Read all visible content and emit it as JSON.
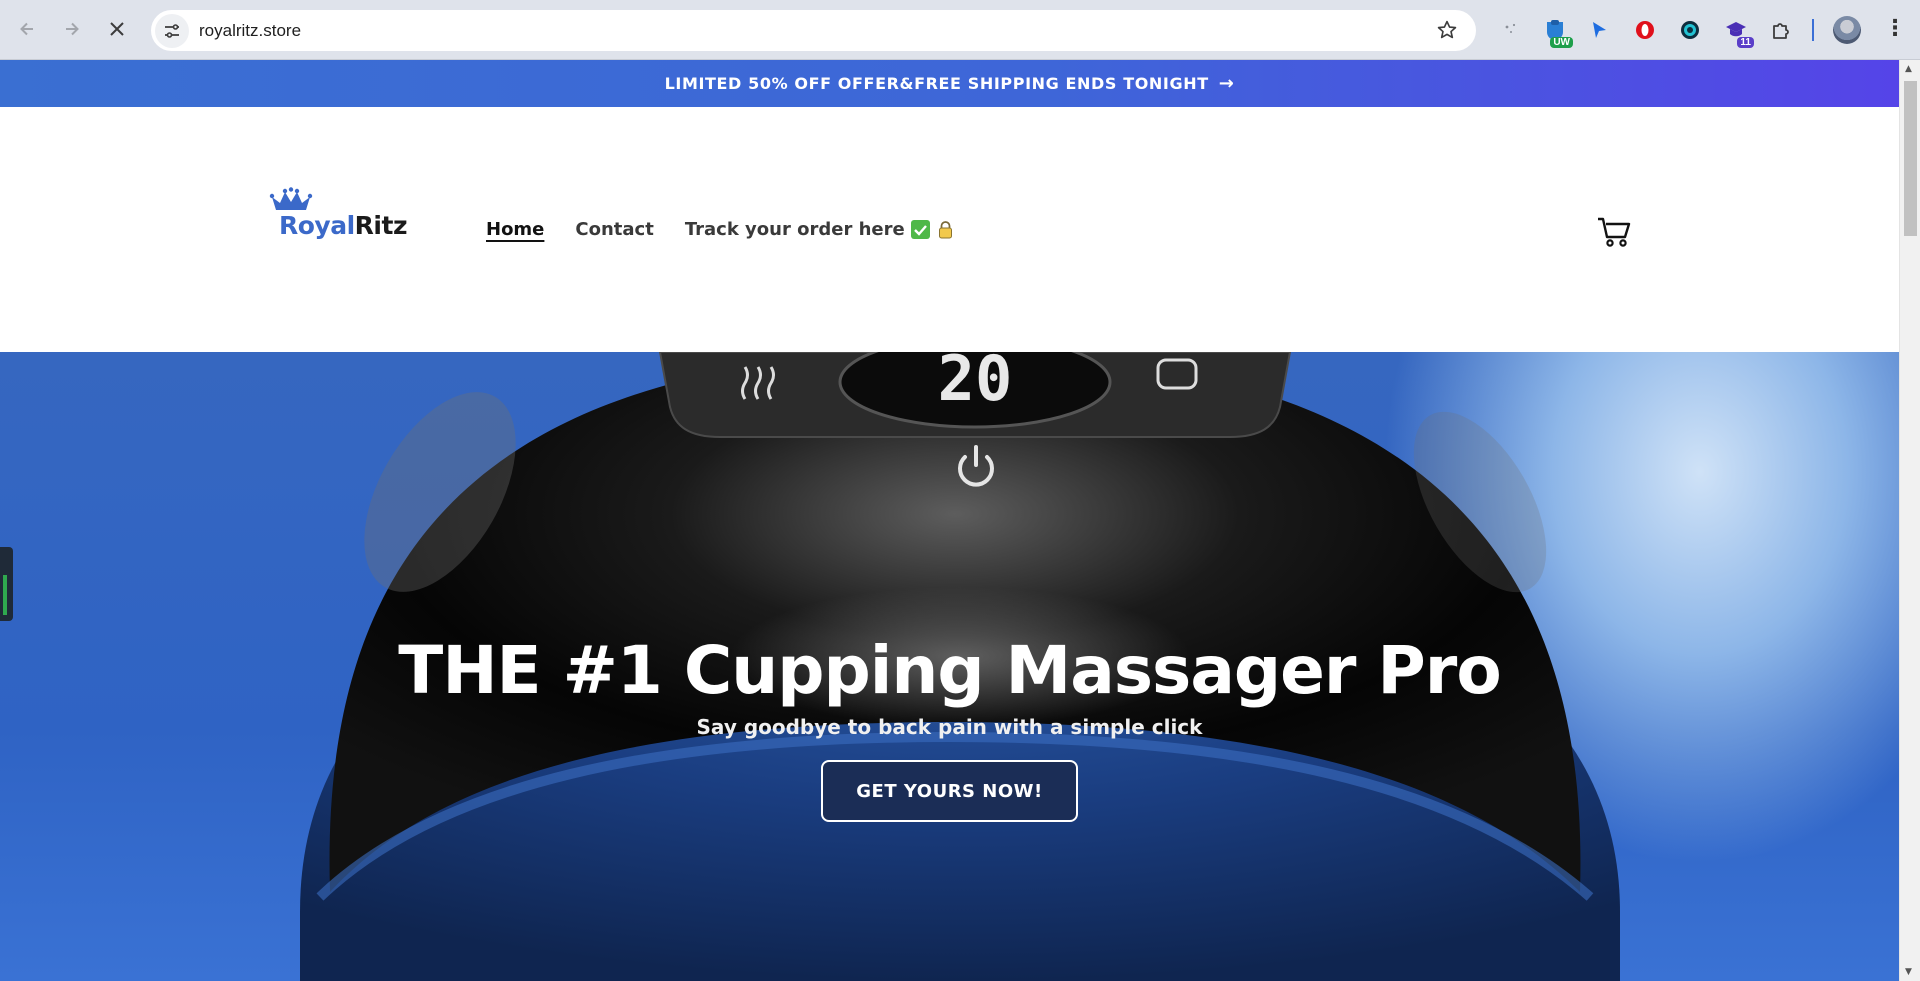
{
  "browser": {
    "url": "royalritz.store",
    "extensions": [
      {
        "name": "sparkle-extension-icon"
      },
      {
        "name": "ublock-extension-icon",
        "badge": "UW"
      },
      {
        "name": "cursor-extension-icon"
      },
      {
        "name": "opera-extension-icon"
      },
      {
        "name": "eye-extension-icon"
      },
      {
        "name": "grad-cap-extension-icon",
        "badge": "11"
      },
      {
        "name": "puzzle-extensions-icon"
      }
    ]
  },
  "announcement": {
    "text": "LIMITED 50% OFF OFFER&FREE SHIPPING ENDS TONIGHT",
    "arrow": "→"
  },
  "header": {
    "logo": {
      "royal": "Royal",
      "ritz": "Ritz"
    },
    "nav": [
      {
        "label": "Home",
        "active": true
      },
      {
        "label": "Contact",
        "active": false
      },
      {
        "label": "Track your order here",
        "active": false
      }
    ]
  },
  "hero": {
    "display_number": "20",
    "title": "THE #1 Cupping Massager Pro",
    "subtitle": "Say goodbye to back pain with a simple click",
    "cta": "GET YOURS NOW!"
  },
  "colors": {
    "announce_start": "#3a6fd2",
    "announce_end": "#5544e8",
    "logo_blue": "#3b69c9",
    "cta_bg": "#1b2d56"
  }
}
